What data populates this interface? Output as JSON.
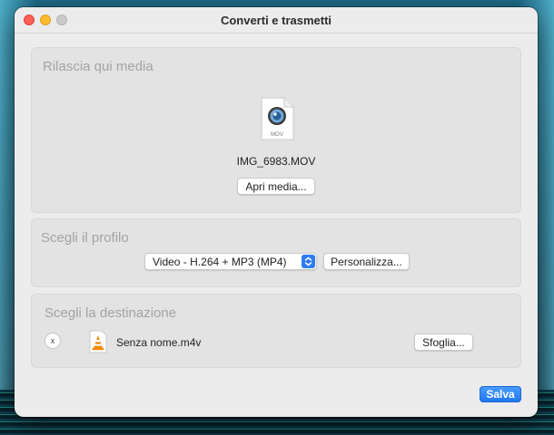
{
  "window": {
    "title": "Converti e trasmetti"
  },
  "media": {
    "section_title": "Rilascia qui media",
    "file_badge": "MOV",
    "file_name": "IMG_6983.MOV",
    "open_button": "Apri media..."
  },
  "profile": {
    "section_title": "Scegli il profilo",
    "selected": "Video - H.264 + MP3 (MP4)",
    "customize_button": "Personalizza..."
  },
  "destination": {
    "section_title": "Scegli la destinazione",
    "clear_label": "x",
    "file_name": "Senza nome.m4v",
    "browse_button": "Sfoglia..."
  },
  "footer": {
    "save_button": "Salva"
  },
  "colors": {
    "accent": "#1f78f0",
    "close": "#ff5f57",
    "minimize": "#febc2e",
    "maximize": "#c9c9c9",
    "vlc_orange": "#f08a0c"
  },
  "icons": {
    "file": "mov-file-icon",
    "vlc": "vlc-cone-icon",
    "select": "chevron-updown-icon"
  }
}
